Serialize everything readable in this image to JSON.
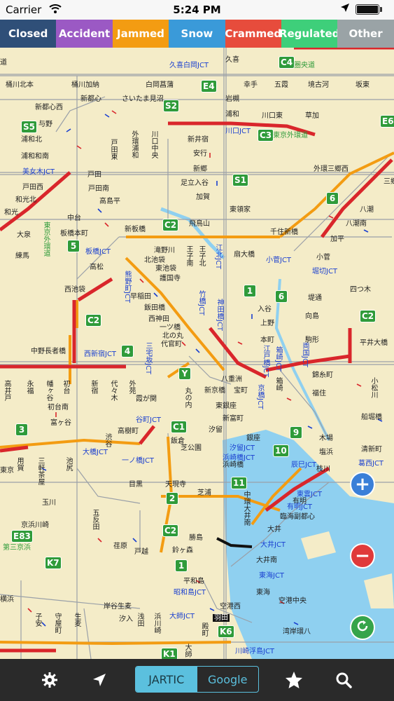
{
  "status_bar": {
    "carrier": "Carrier",
    "time": "5:24 PM"
  },
  "legend": [
    {
      "label": "Closed",
      "color": "#2f4f78"
    },
    {
      "label": "Accident",
      "color": "#9b59c4"
    },
    {
      "label": "Jammed",
      "color": "#f39c12"
    },
    {
      "label": "Snow",
      "color": "#3a9ad9"
    },
    {
      "label": "Crammed",
      "color": "#e74c3c"
    },
    {
      "label": "Regulated",
      "color": "#3ecf7a"
    },
    {
      "label": "Other",
      "color": "#9aa3a6"
    }
  ],
  "map": {
    "places": [
      "道",
      "桶川北本",
      "桶川加納",
      "白岡菖蒲",
      "久喜",
      "幸手",
      "五霞",
      "境古河",
      "坂東",
      "新都心",
      "さいたま見沼",
      "岩槻",
      "浦和",
      "川口東",
      "草加",
      "新都心西",
      "与野",
      "浦和北",
      "浦和和南",
      "戸田東",
      "外環浦和",
      "川口中央",
      "新井宿",
      "安行",
      "新郷",
      "足立入谷",
      "加賀",
      "東領家",
      "戸田",
      "戸田南",
      "高島平",
      "戸田西",
      "和光北",
      "和光",
      "大泉",
      "練馬",
      "中台",
      "板橋本町",
      "新板橋",
      "飛鳥山",
      "滝野川",
      "王子南",
      "王子北",
      "北池袋",
      "東池袋",
      "護国寺",
      "扇大橋",
      "千住新橋",
      "加平",
      "小菅",
      "八潮",
      "八潮南",
      "外環三郷西",
      "三郷",
      "高松",
      "西池袋",
      "早稲田",
      "飯田橋",
      "西神田",
      "一ツ橋",
      "北の丸",
      "代官町",
      "入谷",
      "上野",
      "本町",
      "向島",
      "駒形",
      "堤通",
      "四つ木",
      "中野長者橋",
      "八重洲",
      "新京橋",
      "宝町",
      "箱崎",
      "錦糸町",
      "福住",
      "平井大橋",
      "小松川",
      "新宿",
      "初台",
      "代々木",
      "外苑",
      "霞が関",
      "幡ヶ谷",
      "初台南",
      "富ヶ谷",
      "高樹町",
      "丸の内",
      "東銀座",
      "新富町",
      "汐留",
      "銀座",
      "浜崎橋",
      "芝公園",
      "飯倉",
      "木場",
      "塩浜",
      "枝川",
      "船堀橋",
      "清新町",
      "高井戸",
      "永福",
      "用賀",
      "三軒茶屋",
      "池尻",
      "渋谷",
      "目黒",
      "天現寺",
      "五反田",
      "荏原",
      "戸越",
      "芝浦",
      "中環大井南",
      "有明",
      "臨海副都心",
      "大井",
      "大井南",
      "東海",
      "勝島",
      "鈴ヶ森",
      "平和島",
      "空港西",
      "空港中央",
      "湾岸環八",
      "京浜川崎",
      "東京",
      "玉川",
      "横浜",
      "子安",
      "守屋町",
      "生麦",
      "岸谷生麦",
      "汐入",
      "浅田",
      "浜川崎",
      "殿町",
      "大師"
    ],
    "jcts": [
      "久喜白岡JCT",
      "川口JCT",
      "美女木JCT",
      "江北JCT",
      "板橋JCT",
      "小菅JCT",
      "堀切JCT",
      "熊野町JCT",
      "竹橋JCT",
      "神田橋JCT",
      "江戸橋JCT",
      "箱崎JCT",
      "両国JCT",
      "西新宿JCT",
      "三宅坂JCT",
      "谷町JCT",
      "一ノ橋JCT",
      "浜崎橋JCT",
      "汐留JCT",
      "京橋JCT",
      "辰巳JCT",
      "葛西JCT",
      "大橋JCT",
      "東雲JCT",
      "有明JCT",
      "大井JCT",
      "東海JCT",
      "昭和島JCT",
      "大師JCT",
      "川崎浮島JCT"
    ],
    "ring_labels": [
      "東京外環道",
      "圏央道",
      "第三京浜",
      "東京外環道"
    ],
    "shields": [
      "C4",
      "E4",
      "S2",
      "S5",
      "C3",
      "E6",
      "S1",
      "C2",
      "5",
      "6",
      "C2",
      "1",
      "6",
      "C2",
      "4",
      "Y",
      "3",
      "C1",
      "9",
      "10",
      "11",
      "2",
      "C2",
      "1",
      "E83",
      "K7",
      "K6",
      "K1"
    ],
    "airport": "羽田"
  },
  "controls": {
    "zoom_in": "+",
    "zoom_out": "−"
  },
  "toolbar": {
    "source_jartic": "JARTIC",
    "source_google": "Google"
  },
  "icons": {
    "settings": "gear-icon",
    "locate": "location-arrow-icon",
    "favorite": "star-icon",
    "search": "search-icon",
    "refresh": "refresh-icon"
  }
}
